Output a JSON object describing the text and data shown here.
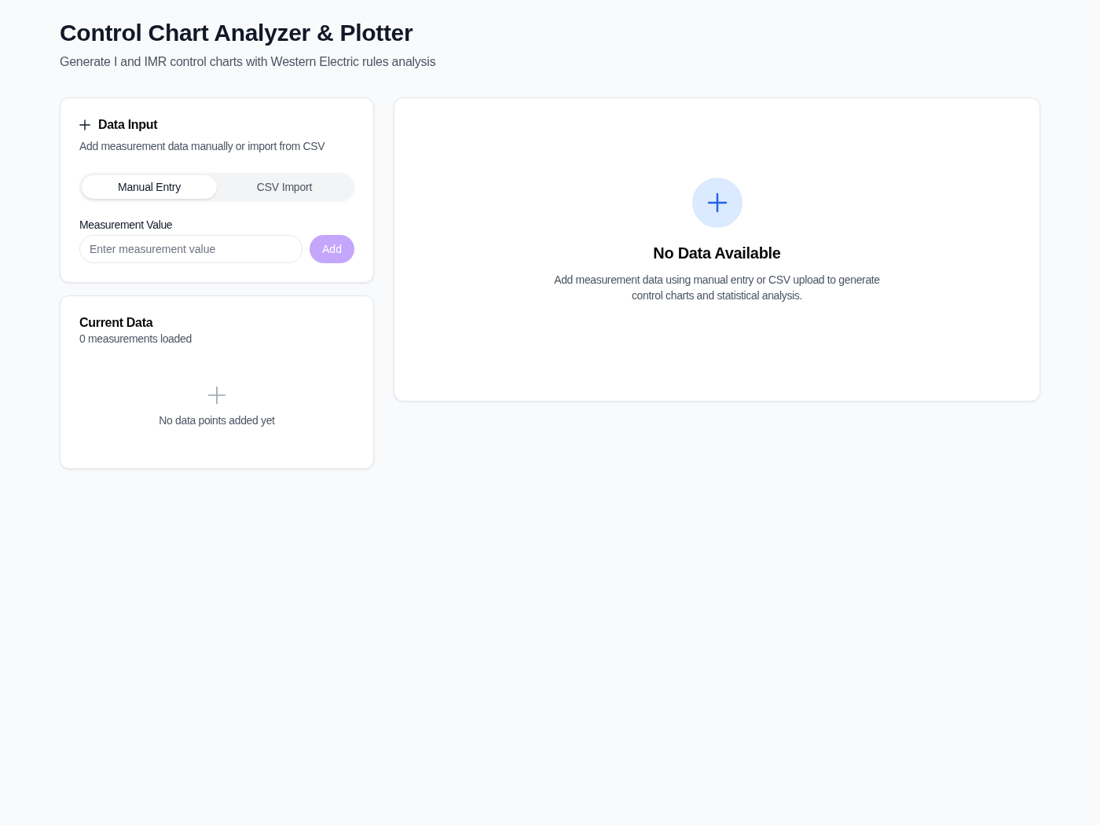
{
  "header": {
    "title": "Control Chart Analyzer & Plotter",
    "subtitle": "Generate I and IMR control charts with Western Electric rules analysis"
  },
  "data_input": {
    "title": "Data Input",
    "description": "Add measurement data manually or import from CSV",
    "tabs": [
      {
        "label": "Manual Entry",
        "selected": true
      },
      {
        "label": "CSV Import",
        "selected": false
      }
    ],
    "field": {
      "label": "Measurement Value",
      "placeholder": "Enter measurement value"
    },
    "add_button": {
      "label": "Add",
      "disabled": true
    }
  },
  "current_data": {
    "title": "Current Data",
    "count": "0 measurements loaded",
    "empty_message": "No data points added yet"
  },
  "chart_panel": {
    "empty_title": "No Data Available",
    "empty_message": "Add measurement data using manual entry or CSV upload to generate control charts and statistical analysis."
  }
}
